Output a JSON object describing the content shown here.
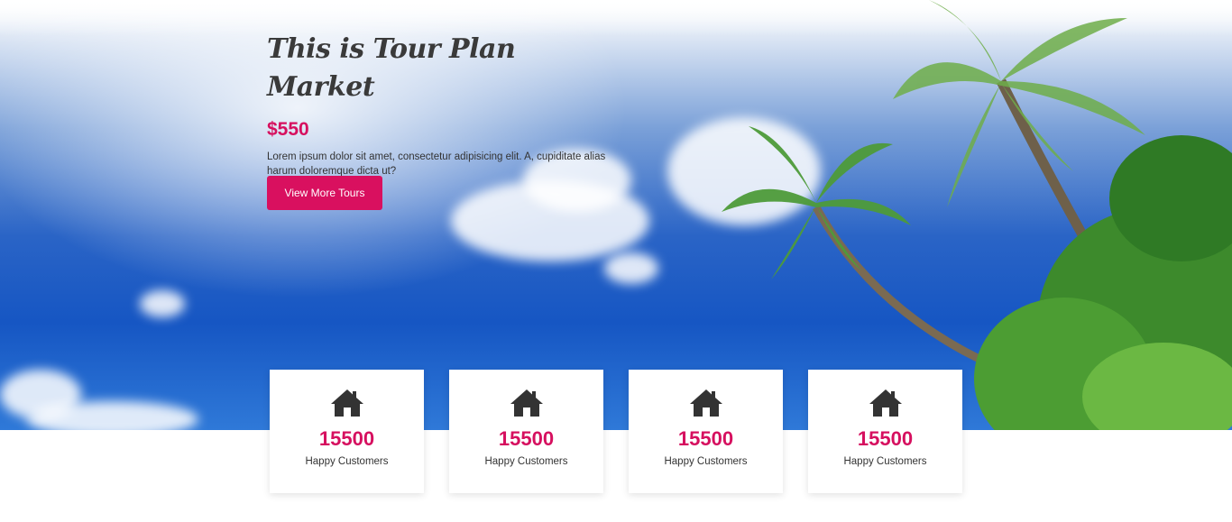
{
  "hero": {
    "title": "This is Tour Plan Market",
    "price": "$550",
    "description": "Lorem ipsum dolor sit amet, consectetur adipisicing elit. A, cupiditate alias harum doloremque dicta ut?",
    "button_label": "View More Tours"
  },
  "stats": [
    {
      "icon": "home-icon",
      "value": "15500",
      "label": "Happy Customers"
    },
    {
      "icon": "home-icon",
      "value": "15500",
      "label": "Happy Customers"
    },
    {
      "icon": "home-icon",
      "value": "15500",
      "label": "Happy Customers"
    },
    {
      "icon": "home-icon",
      "value": "15500",
      "label": "Happy Customers"
    }
  ],
  "colors": {
    "accent": "#d6105f",
    "sky": "#1656c3",
    "text": "#333333"
  }
}
